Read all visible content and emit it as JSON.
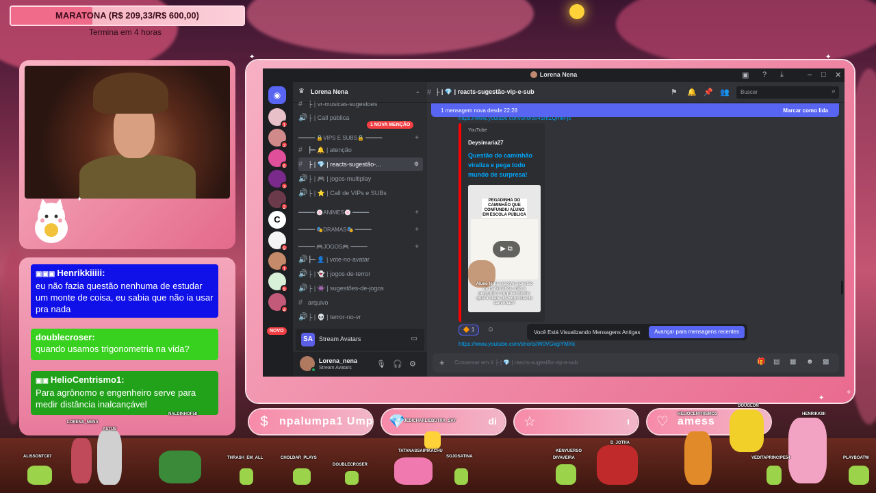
{
  "goal": {
    "label": "MARATONA (R$ 209,33/R$ 600,00)",
    "current": 209.33,
    "target": 600.0,
    "subtitle": "Termina em 4 horas"
  },
  "chat_overlay": {
    "messages": [
      {
        "user": "Henrikkiiiii:",
        "text": "eu não fazia questão nenhuma de estudar um monte de coisa, eu sabia que não ia usar pra nada",
        "color": "#1010e8"
      },
      {
        "user": "doublecroser:",
        "text": "quando usamos trigonometria na vida?",
        "color": "#39d11f"
      },
      {
        "user": "HelioCentrismo1:",
        "text": "Para agrônomo e engenheiro serve para medir distância inalcançável",
        "color": "#22a21b"
      }
    ]
  },
  "discord": {
    "window_title": "Lorena Nena",
    "server_name": "Lorena Nena",
    "mention_pill": "1 NOVA MENÇÃO",
    "new_badge": "NOVO",
    "channels": [
      {
        "type": "text",
        "name": "├ | vr-musicas-sugestoes"
      },
      {
        "type": "voice",
        "name": "├ | Call pública"
      },
      {
        "type": "category",
        "name": "━━━━━ 🔒VIPS E SUBS🔒 ━━━━━"
      },
      {
        "type": "text",
        "name": "┣━ 🔔 | atenção"
      },
      {
        "type": "text",
        "name": "├ | 💎 | reacts-sugestão-...",
        "active": true
      },
      {
        "type": "voice",
        "name": "├ | 🎮 | jogos-multiplay"
      },
      {
        "type": "voice",
        "name": "├ | ⭐ | Call de VIPs e SUBs"
      },
      {
        "type": "category",
        "name": "━━━━━ 🍥ANIMES🍥 ━━━━━"
      },
      {
        "type": "category",
        "name": "━━━━━ 🎭DRAMAS🎭 ━━━━━"
      },
      {
        "type": "category",
        "name": "━━━━━ 🎮JOGOS🎮 ━━━━━"
      },
      {
        "type": "voice",
        "name": "┣━ 👤 | vote-no-avatar"
      },
      {
        "type": "voice",
        "name": "├ | 👻 | jogos-de-terror"
      },
      {
        "type": "voice",
        "name": "├ | 👾 | sugestões-de-jogos"
      },
      {
        "type": "text",
        "name": "arquivo"
      },
      {
        "type": "voice",
        "name": "├ | 💀 | terror-no-vr"
      }
    ],
    "stream_label": "Stream Avatars",
    "user": {
      "name": "Lorena_nena",
      "activity": "Stream Avatars"
    },
    "current_channel": "├ | 💎 | reacts-sugestão-vip-e-sub",
    "search_placeholder": "Buscar",
    "new_messages_banner": "1 mensagem nova desde 22:28",
    "mark_read": "Marcar como lida",
    "partial_link": "https://www.youtube.com/shorts/4SmZQmeFjc",
    "embed": {
      "provider": "YouTube",
      "author": "Deysimaria27",
      "title": "Questão do caminhão viraliza e pega todo mundo de surpresa!",
      "thumb_caption_top": "PEGADINHA DO CAMINHÃO QUE CONFUNDIU ALUNO EM ESCOLA PÚBLICA",
      "thumb_caption_bottom": "Aluno tenta resolver questão de matemática, mas a pergunta é surpreendente: qual a idade do motorista do caminhão?"
    },
    "reaction": {
      "emoji": "🔶",
      "count": "1"
    },
    "old_messages_text": "Você Está Visualizando Mensagens Antigas",
    "old_messages_button": "Avançar para mensagens recentes",
    "link2": "https://www.youtube.com/shorts/W0VGkgiYMXk",
    "composer_placeholder": "Conversar em # ├ | 💎 | reacts-sugestão-vip-e-sub"
  },
  "alerts": [
    {
      "icon": "$",
      "text": "npalumpa1  Ump"
    },
    {
      "icon": "💎",
      "text": "di"
    },
    {
      "icon": "☆",
      "text": "ι"
    },
    {
      "icon": "♡",
      "text": "amess"
    }
  ],
  "viewers": [
    "ALISSONTC87",
    "LORENA_NENA",
    "ASTUS",
    "NALDINHOF58",
    "THRASH_EM_ALL",
    "CHOLDAR_PLAYS",
    "DOUBLECROSER",
    "JEDICHARLIEBUTRA_SAY",
    "TATANASSAIPIKACHU",
    "SOJOSATINA",
    "KENYUERSO",
    "DIVAVEIRA",
    "D_JOTHA",
    "HELIOCENTRISMO1",
    "DOUGLON",
    "HENRIKKIIII",
    "VEDITAPRINCIPE54",
    "PLAYBOATW"
  ]
}
